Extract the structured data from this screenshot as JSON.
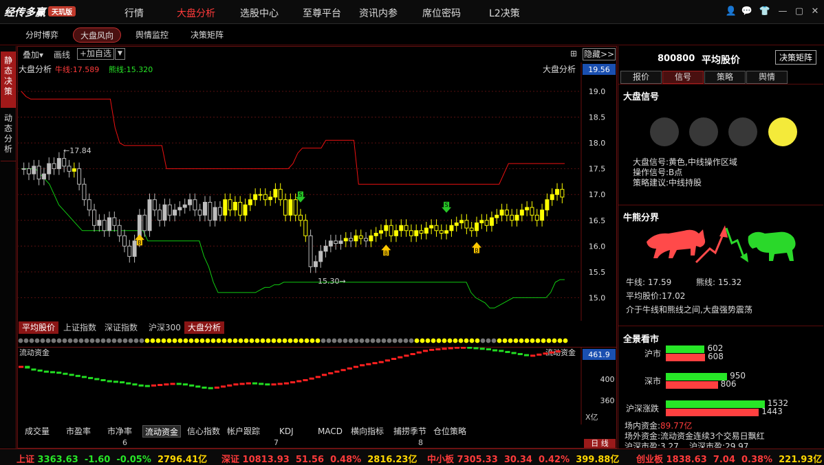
{
  "app": {
    "logo": "经传多赢",
    "edition": "天玑版"
  },
  "menu": [
    "行情",
    "大盘分析",
    "选股中心",
    "至尊平台",
    "资讯内参",
    "席位密码",
    "L2决策"
  ],
  "menu_active": 1,
  "subtabs": [
    "分时博弈",
    "大盘风向",
    "舆情监控",
    "决策矩阵"
  ],
  "subtab_active": 1,
  "side_tabs": [
    "静态决策",
    "动态分析"
  ],
  "toolbar": {
    "overlay": "叠加",
    "draw": "画线",
    "add_watch": "+加自选",
    "hide": "隐藏>>"
  },
  "chart": {
    "title": "大盘分析",
    "title_right": "大盘分析",
    "bull_label": "牛线:17.589",
    "bear_label": "熊线:15.320",
    "price_highlight": "19.56",
    "y_ticks": [
      "19.0",
      "18.5",
      "18.0",
      "17.5",
      "17.0",
      "16.5",
      "16.0",
      "15.5",
      "15.0"
    ],
    "annot_high": "←17.84",
    "annot_low": "15.30→",
    "signal_b": "B",
    "signal_s": "S"
  },
  "index_tabs": [
    "平均股价",
    "上证指数",
    "深证指数",
    "沪深300",
    "大盘分析"
  ],
  "flow": {
    "title_left": "流动资金",
    "title_right": "流动资金",
    "highlight": "461.9",
    "y_ticks": [
      "400",
      "360"
    ],
    "unit": "X亿"
  },
  "bottom_tabs": [
    "成交量",
    "市盈率",
    "市净率",
    "流动资金",
    "信心指数",
    "帐户跟踪",
    "KDJ",
    "MACD",
    "横向指标",
    "捕捞季节",
    "仓位策略"
  ],
  "bottom_tab_active": 3,
  "date_axis": [
    "6",
    "7",
    "8"
  ],
  "day_button": "日 线",
  "stock": {
    "code": "800800",
    "name": "平均股价",
    "matrix_btn": "决策矩阵"
  },
  "right_tabs": [
    "报价",
    "信号",
    "策略",
    "舆情"
  ],
  "right_tab_active": 1,
  "signal": {
    "title": "大盘信号",
    "lights": [
      "off",
      "off",
      "off",
      "yellow"
    ],
    "lines": [
      "大盘信号:黄色,中线操作区域",
      "操作信号:B点",
      "策略建议:中线持股"
    ]
  },
  "bullbear": {
    "title": "牛熊分界",
    "bull": "牛线: 17.59",
    "bear": "熊线: 15.32",
    "avg": "平均股价:17.02",
    "desc": "介于牛线和熊线之间,大盘强势震荡"
  },
  "overview": {
    "title": "全景看市",
    "rows": [
      {
        "label": "沪市",
        "up": 602,
        "down": 608
      },
      {
        "label": "深市",
        "up": 950,
        "down": 806
      },
      {
        "label": "沪深涨跌",
        "up": 1532,
        "down": 1443
      }
    ],
    "lines": [
      "场内资金:89.77亿",
      "场外资金:流动资金连续3个交易日飘红",
      "沪深市盈:3.27",
      "沪深市盈:29.97"
    ],
    "inner_label": "场内资金:",
    "inner_value": "89.77亿"
  },
  "status": [
    {
      "name": "上证",
      "price": "3363.63",
      "chg": "-1.60",
      "pct": "-0.05%",
      "amt": "2796.41亿",
      "dir": "down"
    },
    {
      "name": "深证",
      "price": "10813.93",
      "chg": "51.56",
      "pct": "0.48%",
      "amt": "2816.23亿",
      "dir": "up"
    },
    {
      "name": "中小板",
      "price": "7305.33",
      "chg": "30.34",
      "pct": "0.42%",
      "amt": "399.88亿",
      "dir": "up"
    },
    {
      "name": "创业板",
      "price": "1838.63",
      "chg": "7.04",
      "pct": "0.38%",
      "amt": "221.93亿",
      "dir": "up"
    }
  ],
  "colors": {
    "bg": "#000000",
    "frame": "#6b1111",
    "bull": "#ff2a2a",
    "bear": "#2ad82a",
    "candle": "#ffff00",
    "up_red": "#ff3b3b",
    "down_green": "#27e627"
  },
  "chart_data": {
    "type": "candlestick",
    "title": "大盘分析",
    "ylim": [
      14.8,
      19.2
    ],
    "bull_line": [
      19.0,
      18.9,
      18.85,
      18.85,
      18.85,
      18.85,
      18.85,
      18.85,
      18.85,
      18.85,
      18.85,
      18.85,
      18.85,
      18.85,
      18.85,
      18.85,
      18.85,
      18.85,
      18.85,
      18.85,
      18.3,
      18.0,
      17.95,
      17.95,
      17.95,
      17.95,
      17.95,
      17.95,
      17.95,
      17.95,
      17.95,
      17.5,
      17.5,
      17.5,
      17.5,
      17.5,
      17.5,
      17.5,
      17.5,
      17.5,
      17.5,
      17.5,
      17.5,
      17.5,
      17.5,
      17.5,
      17.5,
      17.5,
      17.5,
      17.5,
      17.5,
      17.5,
      17.5,
      17.5,
      17.5,
      17.5,
      17.5,
      17.5,
      17.6,
      17.8,
      17.9,
      17.9,
      17.9,
      17.9,
      17.9,
      18.05,
      18.05,
      18.05,
      18.05,
      18.05,
      18.05,
      18.05,
      17.2,
      17.2,
      17.2,
      17.2,
      17.2,
      17.2,
      17.2,
      17.2,
      17.2,
      17.2,
      17.2,
      17.2,
      17.2,
      17.2,
      17.2,
      17.2,
      17.2,
      17.2,
      17.2,
      17.2,
      17.2,
      17.2,
      17.2,
      17.2,
      17.2,
      17.2,
      17.2,
      17.2,
      17.2,
      17.2,
      17.2,
      17.4,
      17.6,
      17.6,
      17.6,
      17.6,
      17.6,
      17.6,
      17.6,
      17.6,
      17.6,
      17.6,
      17.6,
      17.6,
      17.6
    ],
    "bear_line": [
      17.5,
      17.5,
      17.5,
      17.5,
      17.4,
      17.3,
      17.2,
      17.0,
      16.8,
      16.7,
      16.6,
      16.5,
      16.4,
      16.3,
      16.3,
      16.3,
      16.3,
      16.3,
      16.3,
      16.3,
      16.3,
      16.3,
      16.3,
      16.3,
      16.3,
      16.3,
      16.3,
      16.1,
      16.1,
      16.1,
      16.1,
      16.1,
      16.1,
      16.1,
      16.1,
      16.1,
      16.1,
      16.1,
      16.1,
      15.8,
      15.6,
      15.3,
      15.1,
      15.1,
      15.1,
      15.1,
      15.1,
      15.1,
      15.1,
      15.1,
      15.1,
      15.15,
      15.2,
      15.2,
      15.25,
      15.25,
      15.3,
      15.3,
      15.3,
      15.3,
      15.3,
      15.3,
      15.3,
      15.3,
      15.3,
      15.3,
      15.3,
      15.3,
      15.3,
      15.3,
      15.3,
      15.3,
      15.3,
      15.3,
      15.3,
      15.3,
      15.3,
      15.3,
      15.3,
      15.3,
      15.3,
      15.3,
      15.3,
      15.3,
      15.3,
      15.3,
      15.3,
      15.3,
      15.3,
      15.3,
      15.3,
      15.3,
      15.3,
      15.3,
      15.3,
      15.3,
      15.1,
      15.0,
      14.95,
      14.9,
      14.8,
      14.8,
      14.85,
      14.9,
      14.95,
      15.0,
      15.0,
      15.0,
      15.0,
      15.0,
      15.0,
      15.0,
      15.0,
      15.1,
      15.3,
      15.35,
      15.35
    ],
    "closes": [
      17.5,
      17.4,
      17.55,
      17.3,
      17.4,
      17.6,
      17.5,
      17.7,
      17.55,
      17.45,
      17.5,
      17.2,
      16.9,
      16.7,
      16.4,
      16.5,
      16.3,
      16.55,
      16.4,
      16.2,
      16.0,
      15.8,
      16.1,
      16.6,
      16.3,
      16.9,
      16.7,
      16.5,
      16.8,
      16.6,
      16.7,
      16.75,
      16.8,
      16.9,
      16.7,
      16.6,
      16.85,
      16.5,
      16.75,
      16.6,
      16.9,
      16.7,
      16.85,
      16.6,
      16.8,
      16.9,
      17.0,
      17.0,
      16.9,
      16.95,
      17.1,
      16.9,
      16.6,
      16.9,
      16.6,
      16.5,
      16.2,
      15.6,
      15.7,
      15.9,
      16.0,
      16.1,
      16.05,
      16.1,
      16.15,
      16.1,
      16.2,
      16.15,
      16.1,
      16.2,
      16.25,
      16.3,
      16.4,
      16.2,
      16.3,
      16.4,
      16.3,
      16.2,
      16.3,
      16.25,
      16.35,
      16.4,
      16.3,
      16.25,
      16.3,
      16.4,
      16.45,
      16.5,
      16.35,
      16.3,
      16.45,
      16.5,
      16.4,
      16.55,
      16.6,
      16.7,
      16.6,
      16.5,
      16.6,
      16.7,
      16.75,
      16.6,
      16.5,
      16.7,
      16.9,
      17.0,
      17.1,
      16.95
    ],
    "signals": [
      {
        "type": "B",
        "index": 23
      },
      {
        "type": "S",
        "index": 55
      },
      {
        "type": "B",
        "index": 72
      },
      {
        "type": "S",
        "index": 84
      },
      {
        "type": "B",
        "index": 90
      }
    ],
    "flow_values": [
      425,
      420,
      418,
      416,
      415,
      414,
      412,
      410,
      408,
      406,
      404,
      402,
      400,
      398,
      397,
      396,
      394,
      392,
      390,
      389,
      388,
      390,
      391,
      392,
      393,
      392,
      390,
      388,
      386,
      385,
      384,
      386,
      388,
      390,
      392,
      393,
      394,
      393,
      392,
      391,
      392,
      393,
      394,
      396,
      398,
      400,
      403,
      406,
      410,
      413,
      416,
      419,
      422,
      425,
      428,
      430,
      432,
      434,
      437,
      440,
      443,
      446,
      449,
      452,
      455,
      457,
      458,
      459,
      460,
      461,
      461,
      460,
      459,
      458,
      456,
      455,
      453,
      451,
      449,
      447,
      445,
      446,
      448,
      450,
      452,
      454
    ]
  }
}
